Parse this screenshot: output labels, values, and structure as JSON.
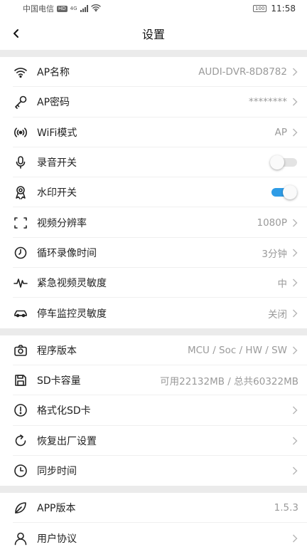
{
  "status_bar": {
    "carrier": "中国电信",
    "hd_badge": "HD",
    "network": "4G",
    "battery": "100",
    "time": "11:58"
  },
  "header": {
    "title": "设置"
  },
  "colors": {
    "accent": "#2f9ce6",
    "separator": "#ebebeb"
  },
  "groups": [
    [
      {
        "icon": "wifi-icon",
        "label": "AP名称",
        "value": "AUDI-DVR-8D8782",
        "type": "nav"
      },
      {
        "icon": "key-icon",
        "label": "AP密码",
        "value": "********",
        "type": "nav"
      },
      {
        "icon": "wifi-mode-icon",
        "label": "WiFi模式",
        "value": "AP",
        "type": "nav"
      },
      {
        "icon": "microphone-icon",
        "label": "录音开关",
        "value": "",
        "type": "toggle",
        "on": false
      },
      {
        "icon": "watermark-icon",
        "label": "水印开关",
        "value": "",
        "type": "toggle",
        "on": true
      },
      {
        "icon": "resolution-icon",
        "label": "视频分辨率",
        "value": "1080P",
        "type": "nav"
      },
      {
        "icon": "timer-icon",
        "label": "循环录像时间",
        "value": "3分钟",
        "type": "nav"
      },
      {
        "icon": "pulse-icon",
        "label": "紧急视频灵敏度",
        "value": "中",
        "type": "nav"
      },
      {
        "icon": "car-icon",
        "label": "停车监控灵敏度",
        "value": "关闭",
        "type": "nav"
      }
    ],
    [
      {
        "icon": "camera-icon",
        "label": "程序版本",
        "value": "MCU / Soc / HW / SW",
        "type": "nav"
      },
      {
        "icon": "sd-card-icon",
        "label": "SD卡容量",
        "value": "可用22132MB / 总共60322MB",
        "type": "info"
      },
      {
        "icon": "alert-icon",
        "label": "格式化SD卡",
        "value": "",
        "type": "nav"
      },
      {
        "icon": "reset-icon",
        "label": "恢复出厂设置",
        "value": "",
        "type": "nav"
      },
      {
        "icon": "clock-icon",
        "label": "同步时间",
        "value": "",
        "type": "nav"
      }
    ],
    [
      {
        "icon": "leaf-icon",
        "label": "APP版本",
        "value": "1.5.3",
        "type": "info"
      },
      {
        "icon": "user-icon",
        "label": "用户协议",
        "value": "",
        "type": "nav"
      }
    ]
  ]
}
